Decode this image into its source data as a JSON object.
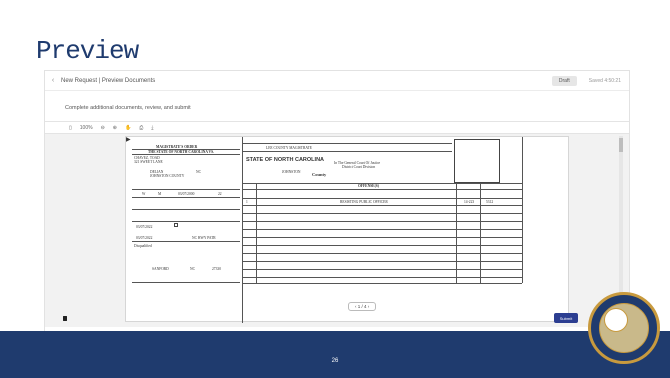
{
  "slide": {
    "title": "Preview",
    "number": "26"
  },
  "app": {
    "breadcrumb": "New Request | Preview Documents",
    "draft_label": "Draft",
    "saved_text": "Saved 4:50:21",
    "subtitle": "Complete additional documents, review, and submit",
    "zoom": "100%",
    "submit_label": "Submit",
    "pager": "‹  1 / 4  ›"
  },
  "form": {
    "order_title": "MAGISTRATE'S ORDER",
    "state_line": "THE STATE OF NORTH CAROLINA VS.",
    "defendant_name": "CHAVEZ, TOAD",
    "defendant_address": "321 SWEET LANE",
    "city": "DELIAN",
    "state": "NC",
    "county_line": "JOHNSTON COUNTY",
    "race": "W",
    "sex": "M",
    "dob": "03/07/2000",
    "age": "22",
    "offense_date": "03/07/2022",
    "arrest_date": "03/07/2022",
    "agency": "NC HWY PATR",
    "arresting_officer": "Disqualified",
    "officer_city": "SANFORD",
    "officer_state": "NC",
    "officer_zip": "27330",
    "file_label": "LEE COUNTY MAGISTRATE",
    "header": "STATE OF NORTH CAROLINA",
    "court_line": "In The General Court Of Justice",
    "court_div": "District Court Division",
    "county_name": "JOHNSTON",
    "county_label": "County",
    "offenses_label": "OFFENSE(S)",
    "offense_count": "1",
    "offense_text": "RESISTING PUBLIC OFFICER",
    "offense_statute": "14-223",
    "offense_code": "5312"
  }
}
